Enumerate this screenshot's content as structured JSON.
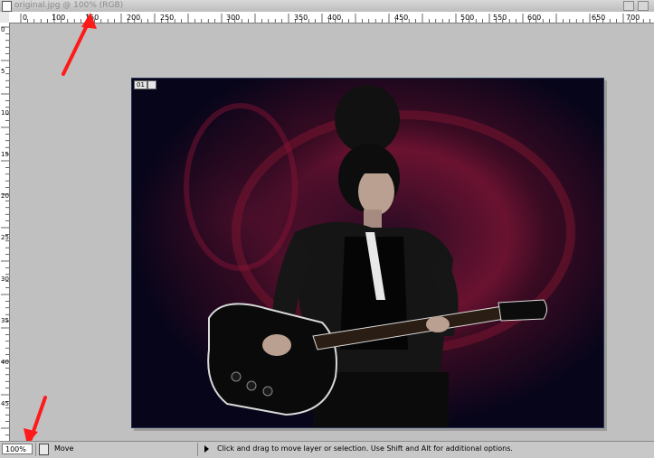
{
  "window": {
    "title": "original.jpg @ 100% (RGB)"
  },
  "rulers": {
    "horizontal_labels": [
      "0",
      "100",
      "150",
      "200",
      "250",
      "300",
      "350",
      "400",
      "450",
      "500",
      "550",
      "600",
      "650",
      "700"
    ],
    "vertical_labels": [
      "0",
      "5",
      "1 0",
      "1 5",
      "2 0",
      "2 5",
      "3 0",
      "3 5",
      "4 0",
      "4 5"
    ]
  },
  "canvas": {
    "frame_badge": "01",
    "photo_description": "woman with dark hair playing black electric guitar on dark red swirl background"
  },
  "statusbar": {
    "zoom": "100%",
    "tool": "Move",
    "hint": "Click and drag to move layer or selection.  Use Shift and Alt for additional options."
  },
  "colors": {
    "workspace_bg": "#c0c0c0",
    "annotation_arrow": "#ff1a1a",
    "photo_bg": "#0a0718",
    "photo_glow": "#8a1530"
  },
  "icons": {
    "title_icon": "document-icon",
    "status_doc_icon": "document-info-icon",
    "status_arrow": "play-arrow-icon",
    "annotation": "red-arrow-annotation"
  }
}
